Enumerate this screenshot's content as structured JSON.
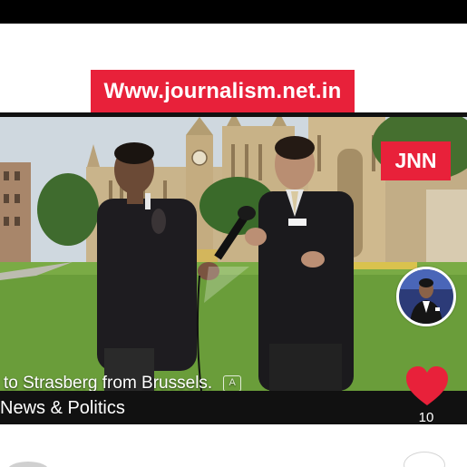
{
  "banner": {
    "text": "Www.journalism.net.in"
  },
  "video": {
    "channel_badge": "JNN",
    "caption": "to Strasberg from Brussels.",
    "cc_icon": "A",
    "category": "News & Politics"
  },
  "actions": {
    "like_count": "10",
    "heart_color": "#e8213a"
  },
  "colors": {
    "brand_red": "#e8213a"
  }
}
